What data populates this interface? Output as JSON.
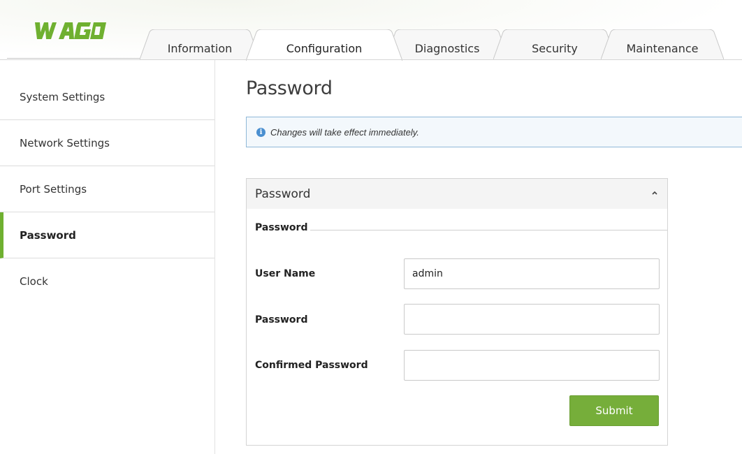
{
  "brand": {
    "logo_text": "WAGO",
    "accent": "#76ae3a",
    "logo_color": "#6fb030"
  },
  "tabs": [
    {
      "label": "Information"
    },
    {
      "label": "Configuration",
      "active": true
    },
    {
      "label": "Diagnostics"
    },
    {
      "label": "Security"
    },
    {
      "label": "Maintenance"
    }
  ],
  "sidebar": {
    "items": [
      {
        "label": "System Settings"
      },
      {
        "label": "Network Settings"
      },
      {
        "label": "Port Settings"
      },
      {
        "label": "Password",
        "active": true
      },
      {
        "label": "Clock"
      }
    ]
  },
  "main": {
    "title": "Password",
    "info": {
      "icon": "info-icon",
      "text": "Changes will take effect immediately."
    },
    "panel": {
      "title": "Password",
      "collapse_icon": "chevron-up-icon",
      "legend": "Password",
      "fields": [
        {
          "label": "User Name",
          "value": "admin"
        },
        {
          "label": "Password",
          "value": ""
        },
        {
          "label": "Confirmed Password",
          "value": ""
        }
      ],
      "submit_label": "Submit"
    }
  }
}
